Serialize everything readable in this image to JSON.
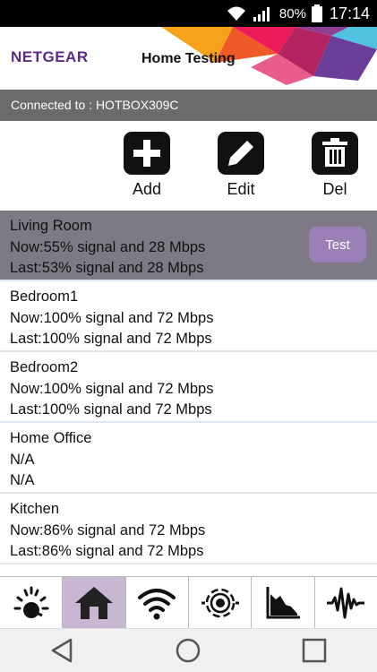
{
  "status_bar": {
    "battery": "80%",
    "time": "17:14"
  },
  "header": {
    "brand": "NETGEAR",
    "title": "Home Testing"
  },
  "connection": {
    "text": "Connected to : HOTBOX309C"
  },
  "toolbar": {
    "add_label": "Add",
    "edit_label": "Edit",
    "del_label": "Del"
  },
  "rooms": [
    {
      "name": "Living Room",
      "now": "Now:55% signal and 28 Mbps",
      "last": "Last:53% signal and 28 Mbps",
      "test_label": "Test"
    },
    {
      "name": "Bedroom1",
      "now": "Now:100% signal and 72 Mbps",
      "last": "Last:100% signal and 72 Mbps"
    },
    {
      "name": "Bedroom2",
      "now": "Now:100% signal and 72 Mbps",
      "last": "Last:100% signal and 72 Mbps"
    },
    {
      "name": "Home Office",
      "now": "N/A",
      "last": "N/A"
    },
    {
      "name": "Kitchen",
      "now": "Now:86% signal and 72 Mbps",
      "last": "Last:86% signal and 72 Mbps"
    }
  ],
  "tabs": [
    {
      "icon": "speedometer-icon"
    },
    {
      "icon": "home-icon",
      "active": true
    },
    {
      "icon": "wifi-icon"
    },
    {
      "icon": "signal-waves-icon"
    },
    {
      "icon": "area-chart-icon"
    },
    {
      "icon": "waveform-icon"
    }
  ],
  "colors": {
    "accent": "#9b80b8",
    "selected_row": "#7d7a86",
    "active_tab": "#c9b6d2",
    "brand": "#5b2a86"
  }
}
